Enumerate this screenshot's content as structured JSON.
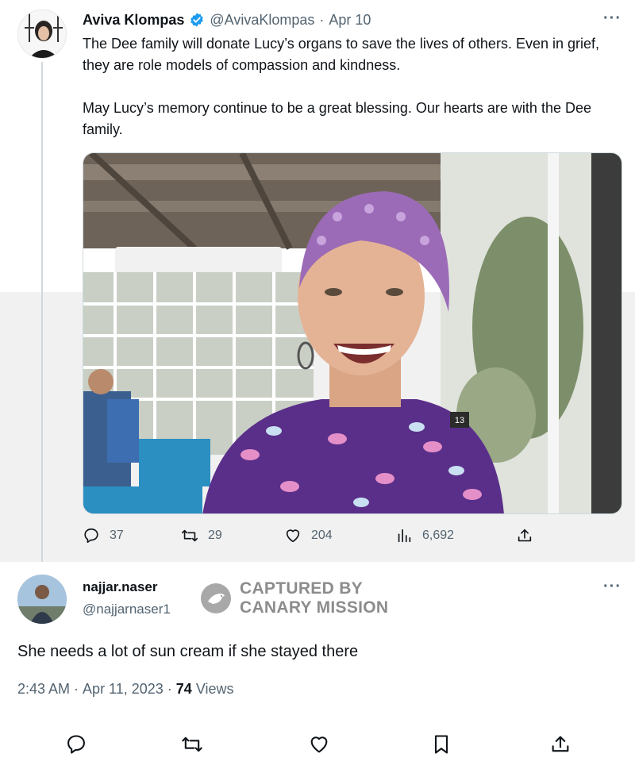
{
  "original_tweet": {
    "author_name": "Aviva Klompas",
    "handle": "@AvivaKlompas",
    "separator": "·",
    "date": "Apr 10",
    "more": "···",
    "text_p1": "The Dee family will donate Lucy’s organs to save the lives of others. Even in grief, they are role models of compassion and kindness.",
    "text_p2": "May Lucy’s memory continue to be a great blessing. Our hearts are with the Dee family.",
    "photo_tag": "13",
    "stats": {
      "replies": "37",
      "retweets": "29",
      "likes": "204",
      "views": "6,692"
    }
  },
  "reply_tweet": {
    "author_name": "najjar.naser",
    "handle": "@najjarnaser1",
    "more": "···",
    "text": "She needs a lot of sun cream if she stayed there",
    "time": "2:43 AM",
    "dot": "·",
    "date": "Apr 11, 2023",
    "dot2": "·",
    "views_count": "74",
    "views_label": "Views"
  },
  "watermark": {
    "line1": "CAPTURED BY",
    "line2": "CANARY MISSION"
  },
  "colors": {
    "accent": "#1d9bf0",
    "secondary_text": "#536471",
    "primary_text": "#0f1419",
    "watermark": "#8c8c8c"
  },
  "icons": {
    "reply": "reply-bubble-icon",
    "retweet": "retweet-icon",
    "like": "heart-icon",
    "views": "views-bar-icon",
    "share": "share-icon",
    "bookmark": "bookmark-icon",
    "verified": "verified-badge-icon"
  }
}
